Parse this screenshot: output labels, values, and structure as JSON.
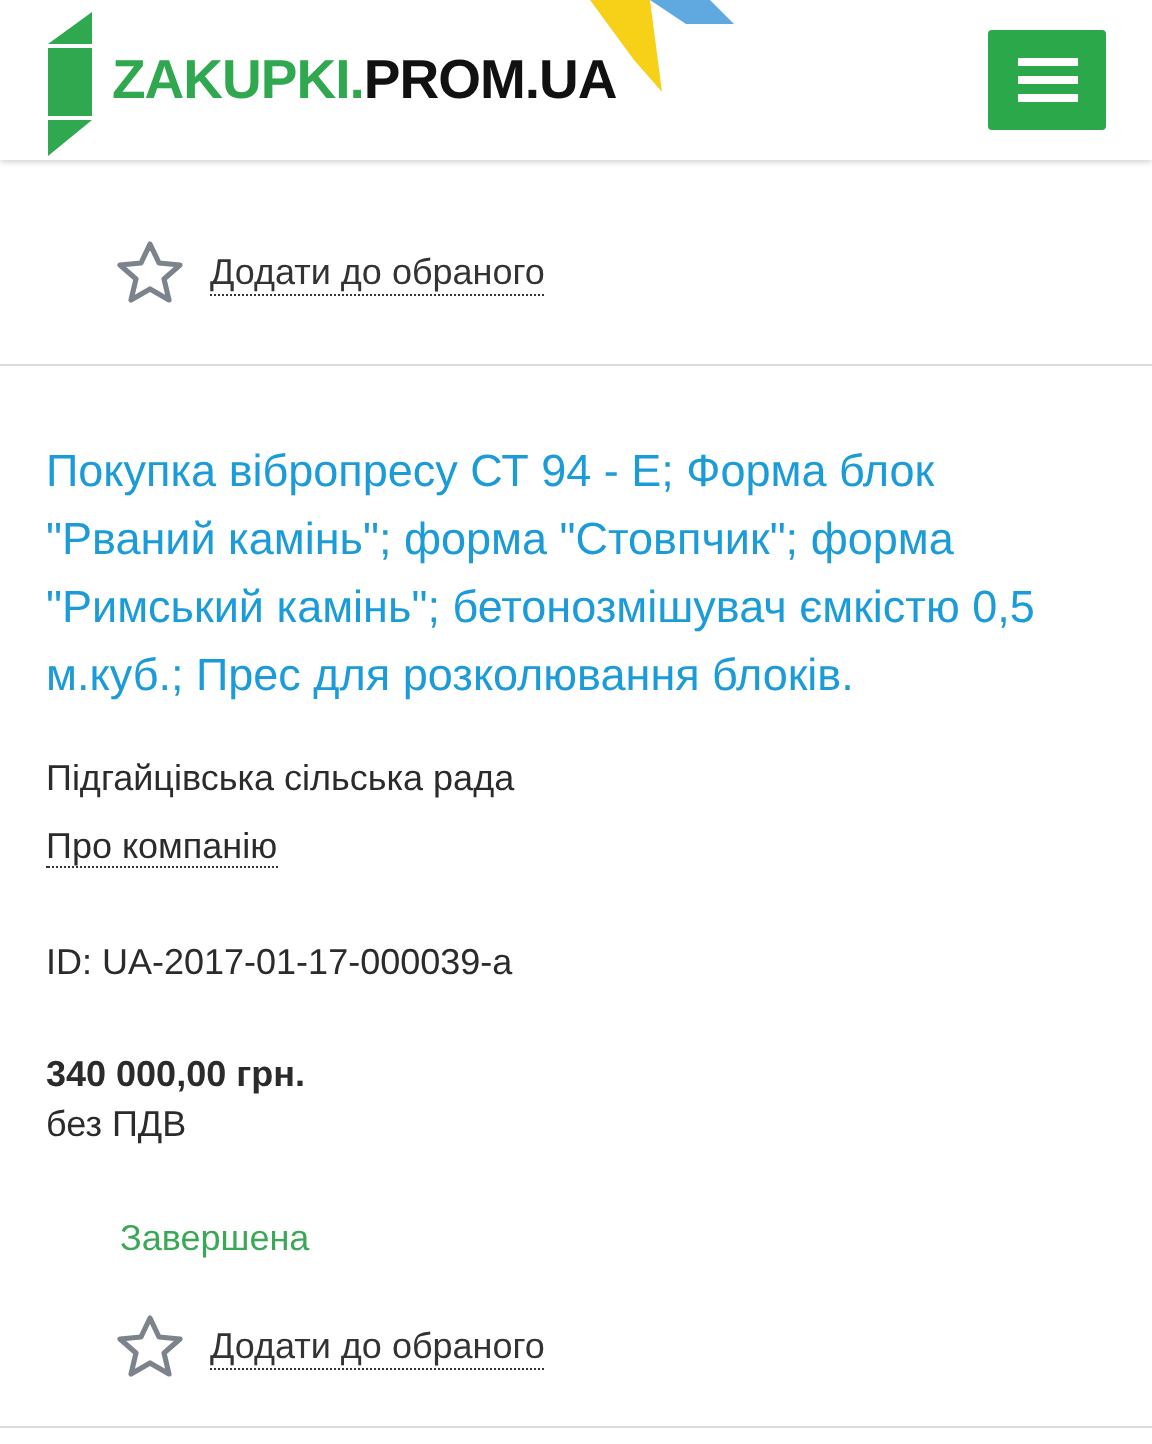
{
  "header": {
    "logo": {
      "brand": "ZAKUPKI.",
      "domain": "PROM.UA"
    }
  },
  "tenders": [
    {
      "favorite": {
        "label": "Додати до обраного",
        "selected": false
      }
    },
    {
      "title": "Покупка вібропресу СТ 94 - Е; Форма блок \"Рваний камінь\"; форма \"Стовпчик\"; форма \"Римський камінь\"; бетонозмішувач ємкістю 0,5 м.куб.; Прес для розколювання блоків.",
      "buyer": "Підгайцівська сільська рада",
      "about_link": "Про компанію",
      "id": "ID: UA-2017-01-17-000039-a",
      "price": "340 000,00 грн.",
      "vat_note": "без ПДВ",
      "status": "Завершена",
      "favorite": {
        "label": "Додати до обраного",
        "selected": false
      }
    }
  ]
}
